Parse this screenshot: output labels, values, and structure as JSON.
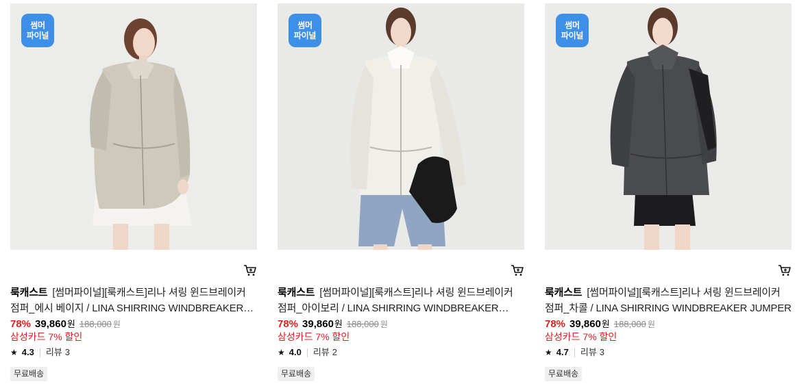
{
  "products": [
    {
      "badge_line1": "썸머",
      "badge_line2": "파이널",
      "brand": "룩캐스트",
      "title": "[썸머파이널][룩캐스트]리나 셔링 윈드브레이커 점퍼_에시 베이지 / LINA SHIRRING WINDBREAKER JUMPER",
      "discount": "78%",
      "price": "39,860",
      "currency": "원",
      "original_price": "188,000",
      "card_promo": "삼성카드 7% 할인",
      "rating": "4.3",
      "reviews_label": "리뷰",
      "reviews_count": "3",
      "shipping": "무료배송",
      "jacket_color": "#cfc9bb",
      "bg_color": "#ececea"
    },
    {
      "badge_line1": "썸머",
      "badge_line2": "파이널",
      "brand": "룩캐스트",
      "title": "[썸머파이널][룩캐스트]리나 셔링 윈드브레이커 점퍼_아이보리 / LINA SHIRRING WINDBREAKER JUMPER",
      "discount": "78%",
      "price": "39,860",
      "currency": "원",
      "original_price": "188,000",
      "card_promo": "삼성카드 7% 할인",
      "rating": "4.0",
      "reviews_label": "리뷰",
      "reviews_count": "2",
      "shipping": "무료배송",
      "jacket_color": "#f1efea",
      "bg_color": "#e9e9e8"
    },
    {
      "badge_line1": "썸머",
      "badge_line2": "파이널",
      "brand": "룩캐스트",
      "title": "[썸머파이널][룩캐스트]리나 셔링 윈드브레이커 점퍼_차콜 / LINA SHIRRING WINDBREAKER JUMPER",
      "discount": "78%",
      "price": "39,860",
      "currency": "원",
      "original_price": "188,000",
      "card_promo": "삼성카드 7% 할인",
      "rating": "4.7",
      "reviews_label": "리뷰",
      "reviews_count": "3",
      "shipping": "무료배송",
      "jacket_color": "#4a4b4e",
      "bg_color": "#ebebea"
    }
  ],
  "icons": {
    "cart": "cart-icon",
    "star": "star-icon"
  },
  "colors": {
    "badge": "#3d8fe8",
    "discount": "#e0201f",
    "promo": "#e0201f"
  }
}
